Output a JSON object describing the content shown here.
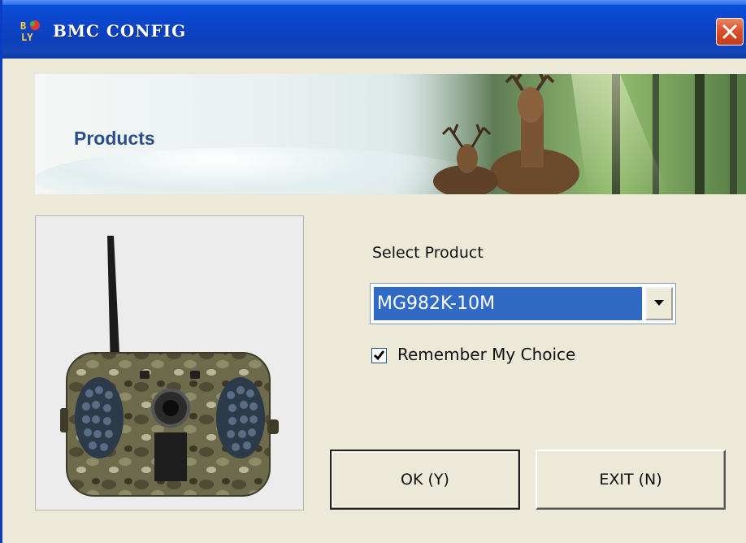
{
  "window": {
    "title": "BMC CONFIG",
    "logo_text": "BC LY",
    "close_icon": "close-icon"
  },
  "banner": {
    "title": "Products"
  },
  "product_image": {
    "icon": "trail-camera-image"
  },
  "form": {
    "select_label": "Select Product",
    "select_value": "MG982K-10M",
    "remember_checked": true,
    "remember_label": "Remember My Choice"
  },
  "buttons": {
    "ok_label": "OK (Y)",
    "exit_label": "EXIT (N)"
  },
  "colors": {
    "titlebar": "#0b45c9",
    "window_bg": "#ece9d8",
    "selection": "#316ac5",
    "close": "#d9512d",
    "banner_text": "#2a4f86"
  }
}
